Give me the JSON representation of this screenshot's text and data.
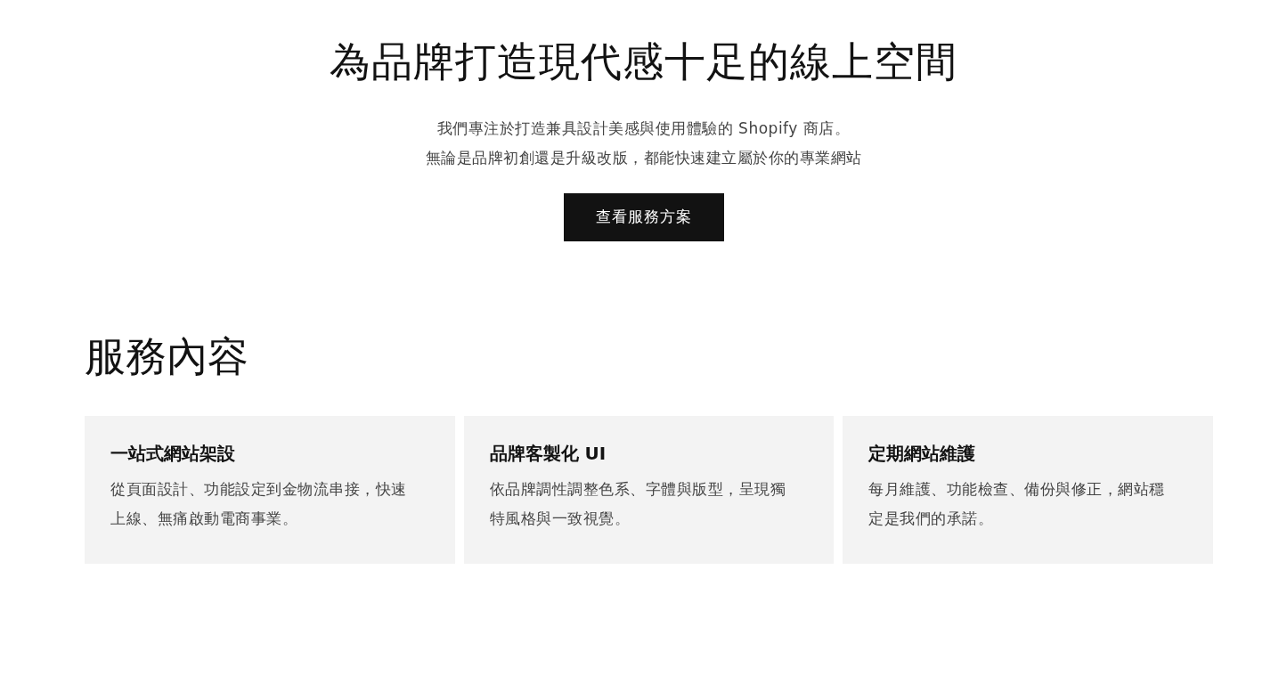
{
  "hero": {
    "title": "為品牌打造現代感十足的線上空間",
    "description_lines": [
      "我們專注於打造兼具設計美感與使用體驗的 Shopify 商店。",
      "無論是品牌初創還是升級改版，都能快速建立屬於你的專業網站"
    ],
    "button": "查看服務方案"
  },
  "services": {
    "heading": "服務內容",
    "cards": [
      {
        "title": "一站式網站架設",
        "body": "從頁面設計、功能設定到金物流串接，快速上線、無痛啟動電商事業。"
      },
      {
        "title": "品牌客製化 UI",
        "body": "依品牌調性調整色系、字體與版型，呈現獨特風格與一致視覺。"
      },
      {
        "title": "定期網站維護",
        "body": "每月維護、功能檢查、備份與修正，網站穩定是我們的承諾。"
      }
    ]
  }
}
